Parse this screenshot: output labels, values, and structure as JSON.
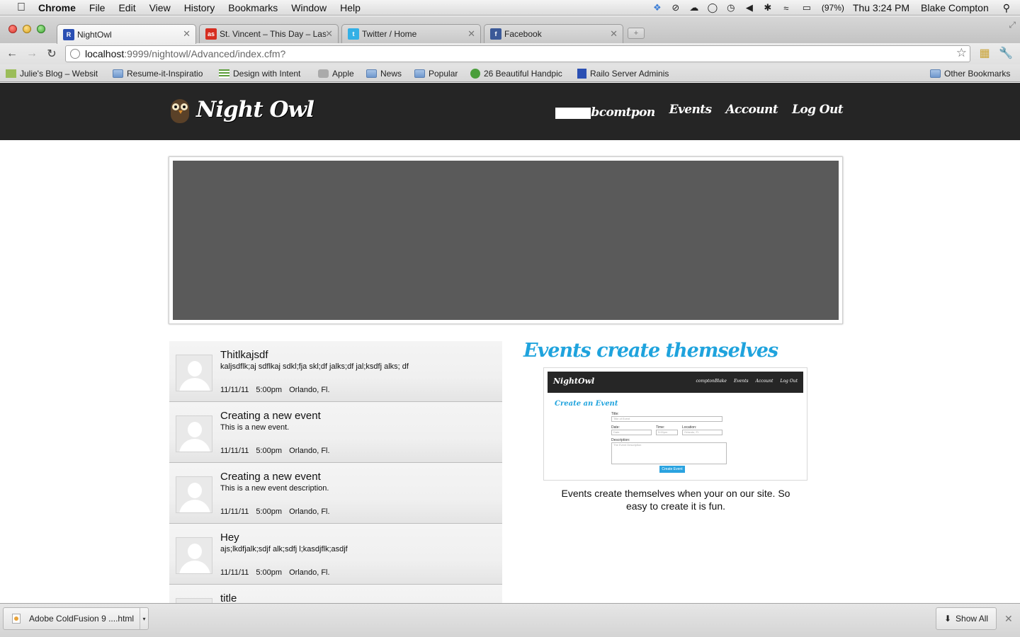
{
  "menubar": {
    "app_name": "Chrome",
    "menus": [
      "File",
      "Edit",
      "View",
      "History",
      "Bookmarks",
      "Window",
      "Help"
    ],
    "battery": "(97%)",
    "clock": "Thu 3:24 PM",
    "user": "Blake Compton",
    "tray_icons": [
      "dropbox-icon",
      "do-not-disturb-icon",
      "cloud-icon",
      "chat-icon",
      "time-machine-icon",
      "volume-icon",
      "bluetooth-icon",
      "wifi-icon",
      "battery-icon"
    ]
  },
  "tabs": [
    {
      "title": "NightOwl",
      "favicon_text": "R",
      "favicon_color": "#2a4fb3",
      "active": true
    },
    {
      "title": "St. Vincent – This Day – Last",
      "favicon_text": "as",
      "favicon_color": "#d62d20",
      "active": false
    },
    {
      "title": "Twitter / Home",
      "favicon_text": "t",
      "favicon_color": "#33b0e6",
      "active": false
    },
    {
      "title": "Facebook",
      "favicon_text": "f",
      "favicon_color": "#3b5998",
      "active": false
    }
  ],
  "address_bar": {
    "host": "localhost",
    "path": ":9999/nightowl/Advanced/index.cfm?"
  },
  "bookmarks": [
    {
      "label": "Julie's Blog – Websit",
      "icon": "bookmark-icon"
    },
    {
      "label": "Resume-it-Inspiratio",
      "icon": "folder-icon"
    },
    {
      "label": "Design with Intent",
      "icon": "bookmark-icon"
    },
    {
      "label": "Apple",
      "icon": "apple-icon"
    },
    {
      "label": "News",
      "icon": "folder-icon"
    },
    {
      "label": "Popular",
      "icon": "folder-icon"
    },
    {
      "label": "26 Beautiful Handpic",
      "icon": "stumbleupon-icon"
    },
    {
      "label": "Railo Server Adminis",
      "icon": "railo-icon"
    }
  ],
  "other_bookmarks": "Other Bookmarks",
  "site": {
    "logo": "Night Owl",
    "nav": {
      "user": "bcomtpon",
      "events": "Events",
      "account": "Account",
      "logout": "Log Out"
    }
  },
  "events": [
    {
      "title": "Thitlkajsdf",
      "description": "kaljsdflk;aj sdflkaj sdkl;fja skl;df jalks;df jal;ksdfj alks; df",
      "date": "11/11/11",
      "time": "5:00pm",
      "location": "Orlando, Fl."
    },
    {
      "title": "Creating a new event",
      "description": "This is a new event.",
      "date": "11/11/11",
      "time": "5:00pm",
      "location": "Orlando, Fl."
    },
    {
      "title": "Creating a new event",
      "description": "This is a new event description.",
      "date": "11/11/11",
      "time": "5:00pm",
      "location": "Orlando, Fl."
    },
    {
      "title": "Hey",
      "description": "ajs;lkdfjalk;sdjf alk;sdfj l;kasdjflk;asdjf",
      "date": "11/11/11",
      "time": "5:00pm",
      "location": "Orlando, Fl."
    },
    {
      "title": "title",
      "description": "",
      "date": "",
      "time": "",
      "location": ""
    }
  ],
  "promo": {
    "title": "Events create themselves",
    "caption": "Events create themselves when your on our site. So easy to create it is fun.",
    "screenshot": {
      "logo": "NightOwl",
      "nav": [
        "comptonBlake",
        "Events",
        "Account",
        "Log Out"
      ],
      "form_title": "Create an Event",
      "title_label": "Title:",
      "title_placeholder": "Title of Event",
      "date_label": "Date:",
      "date_value": "Date",
      "time_label": "Time:",
      "time_value": "5:00pm",
      "location_label": "Location:",
      "location_value": "Orlando, Fl.",
      "description_label": "Description:",
      "description_placeholder": "The Event Description",
      "button": "Create Event"
    }
  },
  "downloads": {
    "file": "Adobe ColdFusion 9 ....html",
    "show_all": "Show All"
  }
}
